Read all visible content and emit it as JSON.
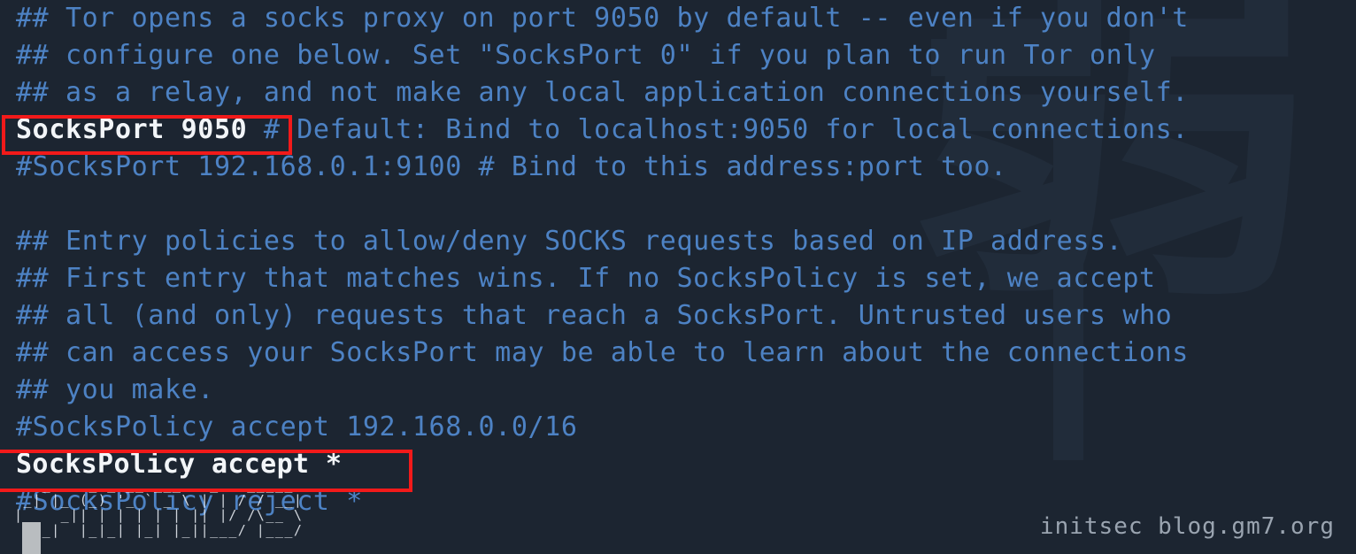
{
  "terminal": {
    "background_color": "#1c2531",
    "comment_color": "#4d82c4",
    "active_color": "#f2f5f8",
    "highlight_color": "#f21a1a",
    "file_type": "torrc",
    "lines": [
      {
        "text": "## Tor opens a socks proxy on port 9050 by default -- even if you don't",
        "kind": "comment"
      },
      {
        "text": "## configure one below. Set \"SocksPort 0\" if you plan to run Tor only",
        "kind": "comment"
      },
      {
        "text": "## as a relay, and not make any local application connections yourself.",
        "kind": "comment"
      },
      {
        "text": "SocksPort 9050 # Default: Bind to localhost:9050 for local connections.",
        "kind": "mixed",
        "active_part": "SocksPort 9050",
        "comment_part": " # Default: Bind to localhost:9050 for local connections."
      },
      {
        "text": "#SocksPort 192.168.0.1:9100 # Bind to this address:port too.",
        "kind": "comment"
      },
      {
        "text": "",
        "kind": "blank"
      },
      {
        "text": "## Entry policies to allow/deny SOCKS requests based on IP address.",
        "kind": "comment"
      },
      {
        "text": "## First entry that matches wins. If no SocksPolicy is set, we accept",
        "kind": "comment"
      },
      {
        "text": "## all (and only) requests that reach a SocksPort. Untrusted users who",
        "kind": "comment"
      },
      {
        "text": "## can access your SocksPort may be able to learn about the connections",
        "kind": "comment"
      },
      {
        "text": "## you make.",
        "kind": "comment"
      },
      {
        "text": "#SocksPolicy accept 192.168.0.0/16",
        "kind": "comment"
      },
      {
        "text": "SocksPolicy accept *",
        "kind": "active"
      },
      {
        "text": "#SocksPolicy reject *",
        "kind": "comment"
      }
    ],
    "highlights": [
      {
        "id": "redbox-socksport",
        "target_text": "SocksPort 9050"
      },
      {
        "id": "redbox-sockspolicy",
        "target_text": "SocksPolicy accept *"
      }
    ],
    "ascii_art": "   _    _ _ __ ___   _   _____\n _| |_ (_) '_ ` _ \\ | | / / __|\n|_   _|| | | | | | || |/ /\\__ \\\n  |_|  |_|_| |_| |_||___/ |___/",
    "cursor": "block"
  },
  "watermarks": {
    "background_glyph": "弱",
    "site_credit": "initsec blog.gm7.org"
  }
}
